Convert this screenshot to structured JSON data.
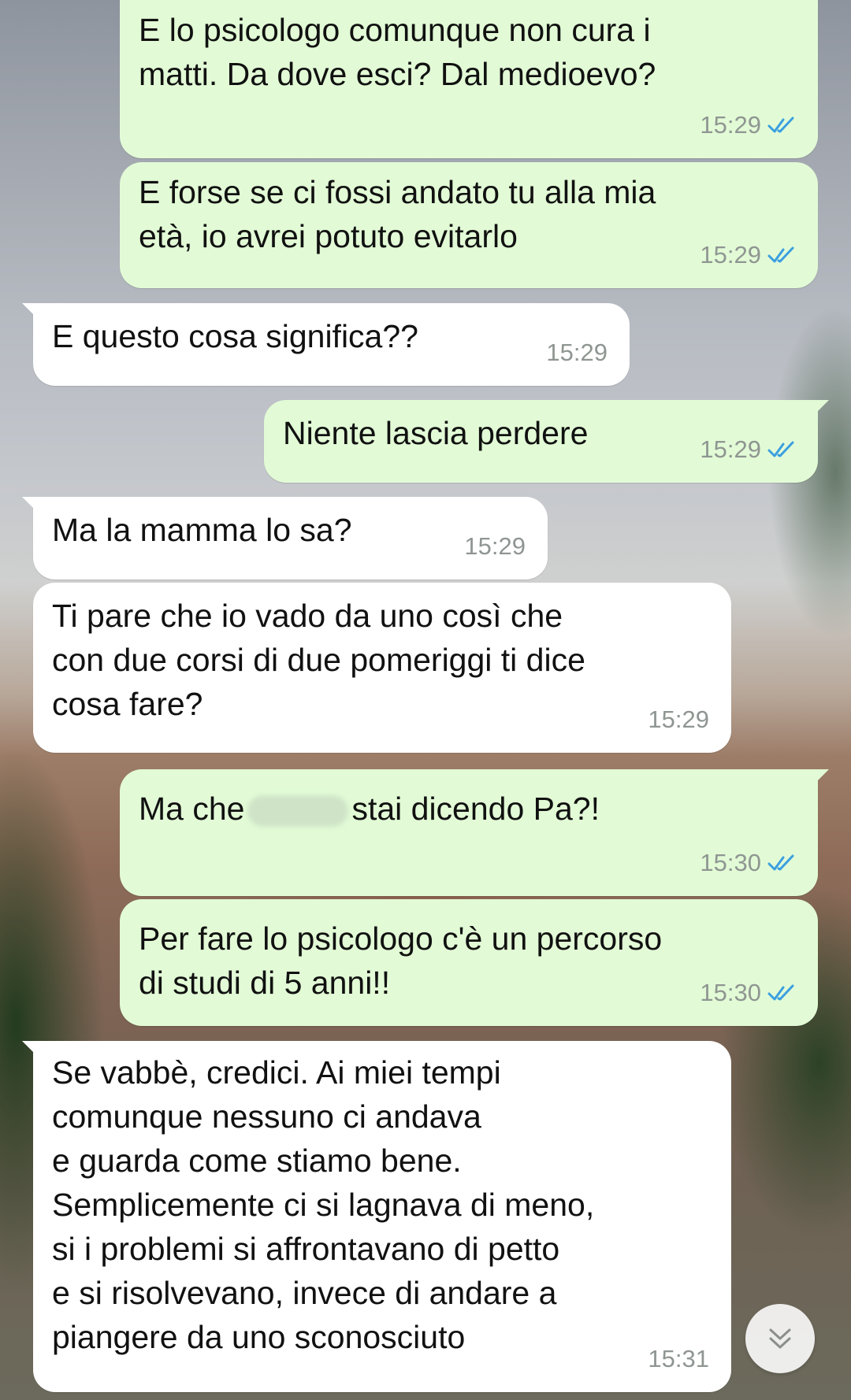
{
  "chat": {
    "messages": [
      {
        "direction": "out",
        "text": "E lo psicologo comunque non cura i\nmatti. Da dove esci? Dal medioevo?",
        "time": "15:29",
        "status": "read"
      },
      {
        "direction": "out",
        "text": "E forse se ci fossi andato tu alla mia\netà, io avrei potuto evitarlo",
        "time": "15:29",
        "status": "read"
      },
      {
        "direction": "in",
        "text": "E questo cosa significa??",
        "time": "15:29"
      },
      {
        "direction": "out",
        "text": "Niente lascia perdere",
        "time": "15:29",
        "status": "read"
      },
      {
        "direction": "in",
        "text": "Ma la mamma lo sa?",
        "time": "15:29"
      },
      {
        "direction": "in",
        "text": "Ti pare che io vado da uno così che\ncon due corsi di due pomeriggi ti dice\ncosa fare?",
        "time": "15:29"
      },
      {
        "direction": "out",
        "text_before": "Ma che",
        "text_after": "stai dicendo Pa?!",
        "time": "15:30",
        "status": "read"
      },
      {
        "direction": "out",
        "text": "Per fare lo psicologo c'è un percorso\ndi studi di 5 anni!!",
        "time": "15:30",
        "status": "read"
      },
      {
        "direction": "in",
        "text": "Se vabbè, credici. Ai miei tempi\ncomunque nessuno ci andava\ne guarda come stiamo bene.\nSemplicemente ci si lagnava di meno,\nsi i problemi si affrontavano di petto\ne si risolvevano, invece di andare a\npiangere da uno sconosciuto",
        "time": "15:31"
      }
    ]
  },
  "colors": {
    "outgoing_bubble": "#e2fbd6",
    "incoming_bubble": "#ffffff",
    "read_ticks": "#3b9fe0",
    "timestamp": "#8f9692"
  },
  "icons": {
    "read_receipt": "double-check-icon",
    "scroll_down": "double-chevron-down-icon"
  }
}
